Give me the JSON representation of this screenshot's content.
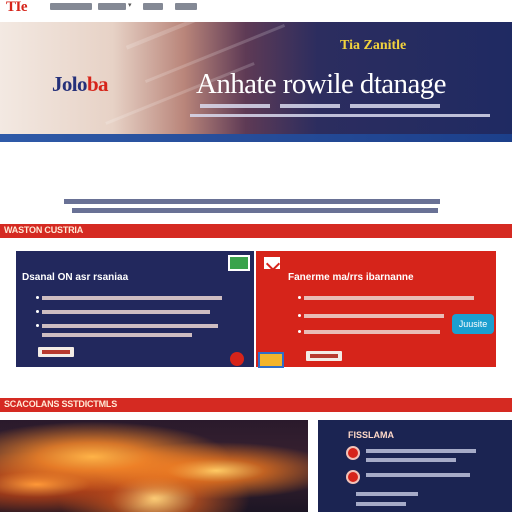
{
  "colors": {
    "brand_red": "#d6241a",
    "brand_navy": "#22285d",
    "accent_yellow": "#f2d33d",
    "accent_blue": "#1b9fd0"
  },
  "header": {
    "logo_text": "TIe",
    "nav_chevron": "▾"
  },
  "hero": {
    "brand_part1": "Jolo",
    "brand_part2": "ba",
    "small_heading": "Tia Zanitle",
    "title": "Anhate rowile dtanage"
  },
  "sections": {
    "section1_label": "WASTON CUSTRIA",
    "section2_label": "SCACOLANS SSTDICTMLS"
  },
  "cards": {
    "left_title": "Dsanal ON asr rsaniaa",
    "right_title": "Fanerme ma/rrs ibarnanne",
    "tag_label": "Juusite"
  },
  "side": {
    "title": "FISSLAMA"
  }
}
